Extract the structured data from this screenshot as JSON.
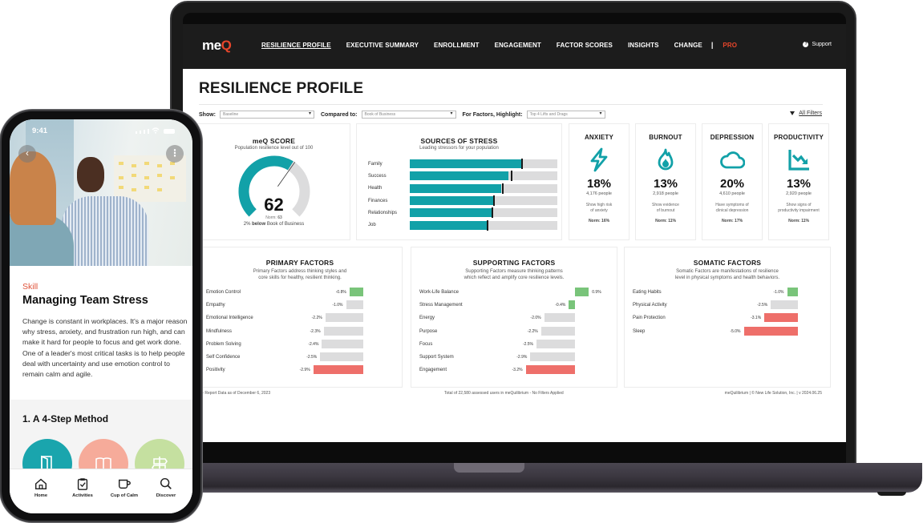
{
  "laptop": {
    "app": {
      "logo": {
        "text": "me",
        "accent": "Q"
      },
      "nav": [
        {
          "label": "RESILIENCE PROFILE",
          "active": true
        },
        {
          "label": "EXECUTIVE SUMMARY"
        },
        {
          "label": "ENROLLMENT"
        },
        {
          "label": "ENGAGEMENT"
        },
        {
          "label": "FACTOR SCORES"
        },
        {
          "label": "INSIGHTS"
        },
        {
          "label": "CHANGE"
        }
      ],
      "nav_separator": "|",
      "nav_pro": "PRO",
      "support_label": "Support",
      "page_title": "RESILIENCE PROFILE",
      "filters": {
        "show_label": "Show:",
        "show_value": "Baseline",
        "compare_label": "Compared to:",
        "compare_value": "Book of Business",
        "highlight_label": "For Factors, Highlight:",
        "highlight_value": "Top 4 Lifts and Drags",
        "all_filters": "All Filters"
      },
      "score": {
        "title": "meQ SCORE",
        "subtitle": "Population resilience level out of 100",
        "value": "62",
        "value_num": 62,
        "norm_num": 63,
        "max": 100,
        "norm_label": "Norm:",
        "norm_value": "63",
        "comparison_pct": "2%",
        "comparison_dir": "below",
        "comparison_target": "Book of Business"
      },
      "stress": {
        "title": "SOURCES OF STRESS",
        "subtitle": "Leading stressors for your population",
        "rows": [
          {
            "label": "Family",
            "value": 0.76,
            "norm": 0.76
          },
          {
            "label": "Success",
            "value": 0.67,
            "norm": 0.69
          },
          {
            "label": "Health",
            "value": 0.62,
            "norm": 0.63
          },
          {
            "label": "Finances",
            "value": 0.57,
            "norm": 0.57
          },
          {
            "label": "Relationships",
            "value": 0.56,
            "norm": 0.56
          },
          {
            "label": "Job",
            "value": 0.53,
            "norm": 0.53
          }
        ]
      },
      "kpis": [
        {
          "title": "ANXIETY",
          "icon": "lightning-icon",
          "value": "18%",
          "people": "4,176 people",
          "desc1": "Show high risk",
          "desc2": "of anxiety",
          "norm": "Norm: 16%"
        },
        {
          "title": "BURNOUT",
          "icon": "flame-icon",
          "value": "13%",
          "people": "2,918 people",
          "desc1": "Show evidence",
          "desc2": "of burnout",
          "norm": "Norm: 11%"
        },
        {
          "title": "DEPRESSION",
          "icon": "cloud-icon",
          "value": "20%",
          "people": "4,610 people",
          "desc1": "Have symptoms of",
          "desc2": "clinical depression",
          "norm": "Norm: 17%"
        },
        {
          "title": "PRODUCTIVITY",
          "icon": "trend-down-icon",
          "value": "13%",
          "people": "2,920 people",
          "desc1": "Show signs of",
          "desc2": "productivity impairment",
          "norm": "Norm: 11%"
        }
      ],
      "factors": {
        "primary": {
          "title": "PRIMARY FACTORS",
          "sub1": "Primary Factors address thinking styles and",
          "sub2": "core skills for healthy, resilient thinking.",
          "rows": [
            {
              "label": "Emotion Control",
              "value": -0.8,
              "text": "-0.8%",
              "highlight": "lift"
            },
            {
              "label": "Empathy",
              "value": -1.0,
              "text": "-1.0%",
              "highlight": "none"
            },
            {
              "label": "Emotional Intelligence",
              "value": -2.2,
              "text": "-2.2%",
              "highlight": "none"
            },
            {
              "label": "Mindfulness",
              "value": -2.3,
              "text": "-2.3%",
              "highlight": "none"
            },
            {
              "label": "Problem Solving",
              "value": -2.4,
              "text": "-2.4%",
              "highlight": "none"
            },
            {
              "label": "Self Confidence",
              "value": -2.5,
              "text": "-2.5%",
              "highlight": "none"
            },
            {
              "label": "Positivity",
              "value": -2.9,
              "text": "-2.9%",
              "highlight": "drag"
            }
          ]
        },
        "supporting": {
          "title": "SUPPORTING FACTORS",
          "sub1": "Supporting Factors measure thinking patterns",
          "sub2": "which reflect and amplify core resilience levels.",
          "rows": [
            {
              "label": "Work-Life Balance",
              "value": 0.9,
              "text": "0.9%",
              "highlight": "lift"
            },
            {
              "label": "Stress Management",
              "value": -0.4,
              "text": "-0.4%",
              "highlight": "lift"
            },
            {
              "label": "Energy",
              "value": -2.0,
              "text": "-2.0%",
              "highlight": "none"
            },
            {
              "label": "Purpose",
              "value": -2.2,
              "text": "-2.2%",
              "highlight": "none"
            },
            {
              "label": "Focus",
              "value": -2.5,
              "text": "-2.5%",
              "highlight": "none"
            },
            {
              "label": "Support System",
              "value": -2.9,
              "text": "-2.9%",
              "highlight": "none"
            },
            {
              "label": "Engagement",
              "value": -3.2,
              "text": "-3.2%",
              "highlight": "drag"
            }
          ]
        },
        "somatic": {
          "title": "SOMATIC FACTORS",
          "sub1": "Somatic Factors are manifestations of resilience",
          "sub2": "level in physical symptoms and health behaviors.",
          "rows": [
            {
              "label": "Eating Habits",
              "value": -1.0,
              "text": "-1.0%",
              "highlight": "lift"
            },
            {
              "label": "Physical Activity",
              "value": -2.5,
              "text": "-2.5%",
              "highlight": "none"
            },
            {
              "label": "Pain Protection",
              "value": -3.1,
              "text": "-3.1%",
              "highlight": "drag"
            },
            {
              "label": "Sleep",
              "value": -5.0,
              "text": "-5.0%",
              "highlight": "drag"
            }
          ]
        }
      },
      "footer": {
        "left": "me - Report Data as of December 6, 2023",
        "center": "Total of 22,580 assessed users in meQuilibrium - No Filters Applied",
        "right": "meQuilibrium | © New Life Solution, Inc. | v 2024.06.25"
      },
      "colors": {
        "teal": "#12a1a8",
        "track": "#dcdcdd",
        "lift": "#79c47a",
        "drag": "#ee6f6a",
        "accent": "#e8462b",
        "nav_bg": "#1c1c1c"
      }
    }
  },
  "phone": {
    "status_time": "9:41",
    "back_label": "‹",
    "more_label": "⋮",
    "skill_tag": "Skill",
    "skill_title": "Managing Team Stress",
    "skill_body": "Change is constant in workplaces. It's a major reason why stress, anxiety, and frustration run high, and can make it hard for people to focus and get work done. One of a leader's most critical tasks is to help people deal with uncertainty and use emotion control to remain calm and agile.",
    "method_title": "1. A 4-Step Method",
    "steps": [
      {
        "icon": "door-icon",
        "color": "#1aa5ad"
      },
      {
        "icon": "book-icon",
        "color": "#f6ab9a"
      },
      {
        "icon": "signpost-icon",
        "color": "#c5e0a0"
      }
    ],
    "tabs": [
      {
        "label": "Home",
        "icon": "home-icon"
      },
      {
        "label": "Activities",
        "icon": "clipboard-check-icon"
      },
      {
        "label": "Cup of Calm",
        "icon": "cup-icon"
      },
      {
        "label": "Discover",
        "icon": "search-icon"
      }
    ]
  }
}
